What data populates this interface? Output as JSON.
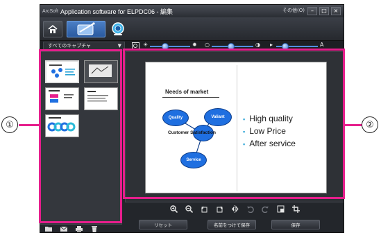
{
  "callouts": {
    "left": "①",
    "right": "②"
  },
  "window": {
    "brand": "ArcSoft",
    "title": "Application software for ELPDC06 - 編集",
    "options_label": "その他(O)",
    "controls": {
      "minimize": "–",
      "maximize": "□",
      "close": "×"
    }
  },
  "toolbar": {
    "home_icon": "home-icon",
    "capture_icon": "capture-icon",
    "camera_icon": "camera-icon"
  },
  "capture_filter": {
    "selected": "すべてのキャプチャ"
  },
  "adjust": {
    "brightness_level": 0.35,
    "contrast_level": 0.45,
    "sharpness_level": 0.15
  },
  "thumbnails": [
    {
      "name": "thumb-1",
      "selected": true
    },
    {
      "name": "thumb-2",
      "selected": false
    },
    {
      "name": "thumb-3",
      "selected": false
    },
    {
      "name": "thumb-4",
      "selected": false
    },
    {
      "name": "thumb-5",
      "selected": false
    }
  ],
  "slide": {
    "title": "Needs of market",
    "bubbles": [
      "Quality",
      "Valiant",
      "Service"
    ],
    "center_label": "Customer Satisfaction",
    "bullets": [
      "High quality",
      "Low Price",
      "After service"
    ]
  },
  "actions": {
    "reset": "リセット",
    "save_as": "名前をつけて保存",
    "save": "保存"
  }
}
